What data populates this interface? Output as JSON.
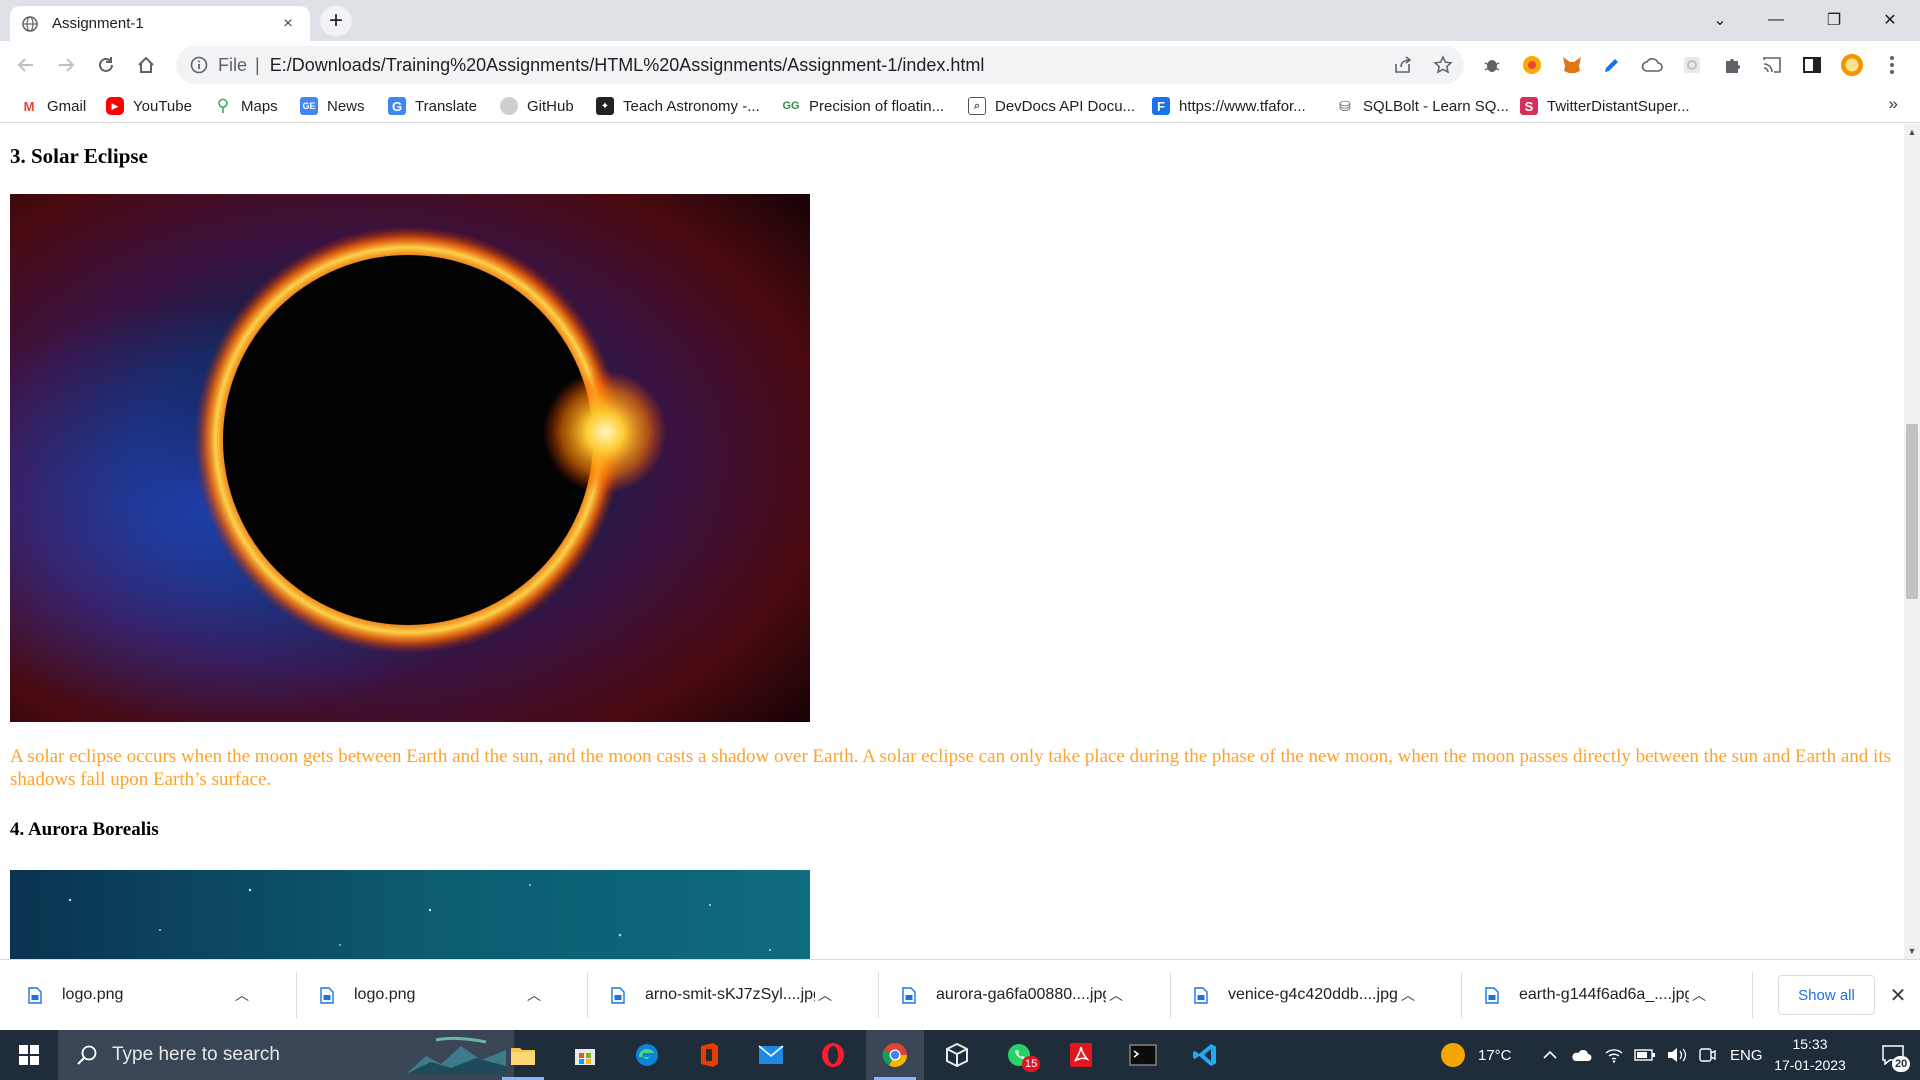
{
  "browser": {
    "tab": {
      "title": "Assignment-1",
      "close": "×"
    },
    "new_tab": "+",
    "window_controls": {
      "tab_search": "⌄",
      "minimize": "—",
      "restore": "❐",
      "close": "✕"
    },
    "address": {
      "scheme": "File",
      "separator": "|",
      "url": "E:/Downloads/Training%20Assignments/HTML%20Assignments/Assignment-1/index.html"
    },
    "bookmarks": [
      {
        "label": "Gmail",
        "icon": "gmail-icon",
        "color": "#ea4335"
      },
      {
        "label": "YouTube",
        "icon": "youtube-icon",
        "color": "#ff0000"
      },
      {
        "label": "Maps",
        "icon": "maps-icon",
        "color": "#34a853"
      },
      {
        "label": "News",
        "icon": "news-icon",
        "color": "#4285f4"
      },
      {
        "label": "Translate",
        "icon": "translate-icon",
        "color": "#4285f4"
      },
      {
        "label": "GitHub",
        "icon": "github-icon",
        "color": "#cfcfcf"
      },
      {
        "label": "Teach Astronomy -...",
        "icon": "astronomy-icon",
        "color": "#222222"
      },
      {
        "label": "Precision of floatin...",
        "icon": "geeks-icon",
        "color": "#2f8d46"
      },
      {
        "label": "DevDocs API Docu...",
        "icon": "devdocs-icon",
        "color": "#555555"
      },
      {
        "label": "https://www.tfafor...",
        "icon": "f-icon",
        "color": "#1a73e8"
      },
      {
        "label": "SQLBolt - Learn SQ...",
        "icon": "database-icon",
        "color": "#555555"
      },
      {
        "label": "TwitterDistantSuper...",
        "icon": "s-icon",
        "color": "#d62f5a"
      }
    ],
    "bookmarks_more": "»"
  },
  "page": {
    "section3_heading": "3. Solar Eclipse",
    "section3_paragraph": "A solar eclipse occurs when the moon gets between Earth and the sun, and the moon casts a shadow over Earth. A solar eclipse can only take place during the phase of the new moon, when the moon passes directly between the sun and Earth and its shadows fall upon Earth’s surface.",
    "section4_heading": "4. Aurora Borealis",
    "paragraph_color": "#ffa229"
  },
  "downloads": {
    "items": [
      {
        "name": "logo.png"
      },
      {
        "name": "logo.png"
      },
      {
        "name": "arno-smit-sKJ7zSyl....jpg"
      },
      {
        "name": "aurora-ga6fa00880....jpg"
      },
      {
        "name": "venice-g4c420ddb....jpg"
      },
      {
        "name": "earth-g144f6ad6a_....jpg"
      }
    ],
    "show_all": "Show all",
    "close": "✕"
  },
  "taskbar": {
    "search_placeholder": "Type here to search",
    "whatsapp_badge": "15",
    "weather": "17°C",
    "language": "ENG",
    "time": "15:33",
    "date": "17-01-2023",
    "notifications_count": "20"
  }
}
